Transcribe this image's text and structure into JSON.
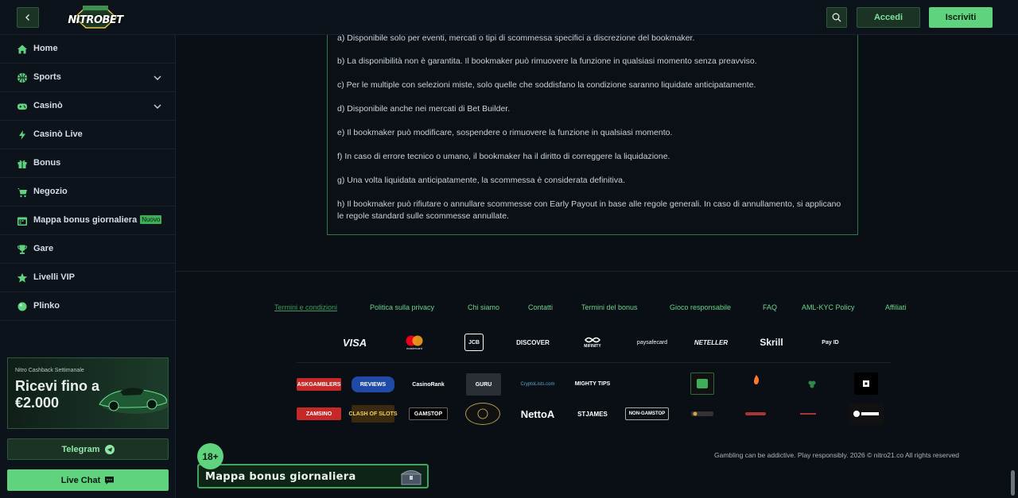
{
  "header": {
    "logo_text": "NITROBET",
    "login_label": "Accedi",
    "signup_label": "Iscriviti"
  },
  "sidebar": {
    "items": [
      {
        "label": "Home",
        "icon": "home-icon"
      },
      {
        "label": "Sports",
        "icon": "sports-ball-icon",
        "expandable": true
      },
      {
        "label": "Casinò",
        "icon": "gamepad-icon",
        "expandable": true
      },
      {
        "label": "Casinò Live",
        "icon": "lightning-icon"
      },
      {
        "label": "Bonus",
        "icon": "gift-icon"
      },
      {
        "label": "Negozio",
        "icon": "cart-icon"
      },
      {
        "label": "Mappa bonus giornaliera",
        "icon": "calendar-icon",
        "badge": "Nuovo"
      },
      {
        "label": "Gare",
        "icon": "trophy-icon"
      },
      {
        "label": "Livelli VIP",
        "icon": "star-icon"
      },
      {
        "label": "Plinko",
        "icon": "plinko-icon"
      }
    ],
    "promo": {
      "subtitle": "Nitro Cashback Settimanale",
      "title": "Ricevi fino a €2.000"
    },
    "telegram_label": "Telegram",
    "livechat_label": "Live Chat"
  },
  "terms": {
    "lines": [
      "a) Disponibile solo per eventi, mercati o tipi di scommessa specifici a discrezione del bookmaker.",
      "b) La disponibilità non è garantita. Il bookmaker può rimuovere la funzione in qualsiasi momento senza preavviso.",
      "c) Per le multiple con selezioni miste, solo quelle che soddisfano la condizione saranno liquidate anticipatamente.",
      "d) Disponibile anche nei mercati di Bet Builder.",
      "e) Il bookmaker può modificare, sospendere o rimuovere la funzione in qualsiasi momento.",
      "f) In caso di errore tecnico o umano, il bookmaker ha il diritto di correggere la liquidazione.",
      "g) Una volta liquidata anticipatamente, la scommessa è considerata definitiva.",
      "h) Il bookmaker può rifiutare o annullare scommesse con Early Payout in base alle regole generali. In caso di annullamento, si applicano le regole standard sulle scommesse annullate."
    ]
  },
  "footer": {
    "links": [
      "Termini e condizioni",
      "Politica sulla privacy",
      "Chi siamo",
      "Contatti",
      "Termini del bonus",
      "Gioco responsabile",
      "FAQ",
      "AML-KYC Policy",
      "Affiliati"
    ],
    "payments": [
      "VISA",
      "mastercard",
      "JCB",
      "DISCOVER",
      "MiFINITY",
      "paysafecard",
      "NETELLER",
      "Skrill",
      "Pay ID"
    ],
    "partners_row1": [
      "ASKGAMBLERS",
      "REVIEWS",
      "CasinoRank",
      "GURU",
      "CryptoLists.com",
      "MIGHTY TIPS"
    ],
    "partners_row2": [
      "ZAMSINO",
      "CLASH OF SLOTS",
      "GAMSTOP",
      "NettoA",
      "STJAMES",
      "NON-GAMSTOP"
    ],
    "age_badge": "18+",
    "bonus_map_label": "Mappa bonus giornaliera",
    "copyright": "Gambling can be addictive. Play responsibly. 2026 © nitro21.co All rights reserved"
  }
}
